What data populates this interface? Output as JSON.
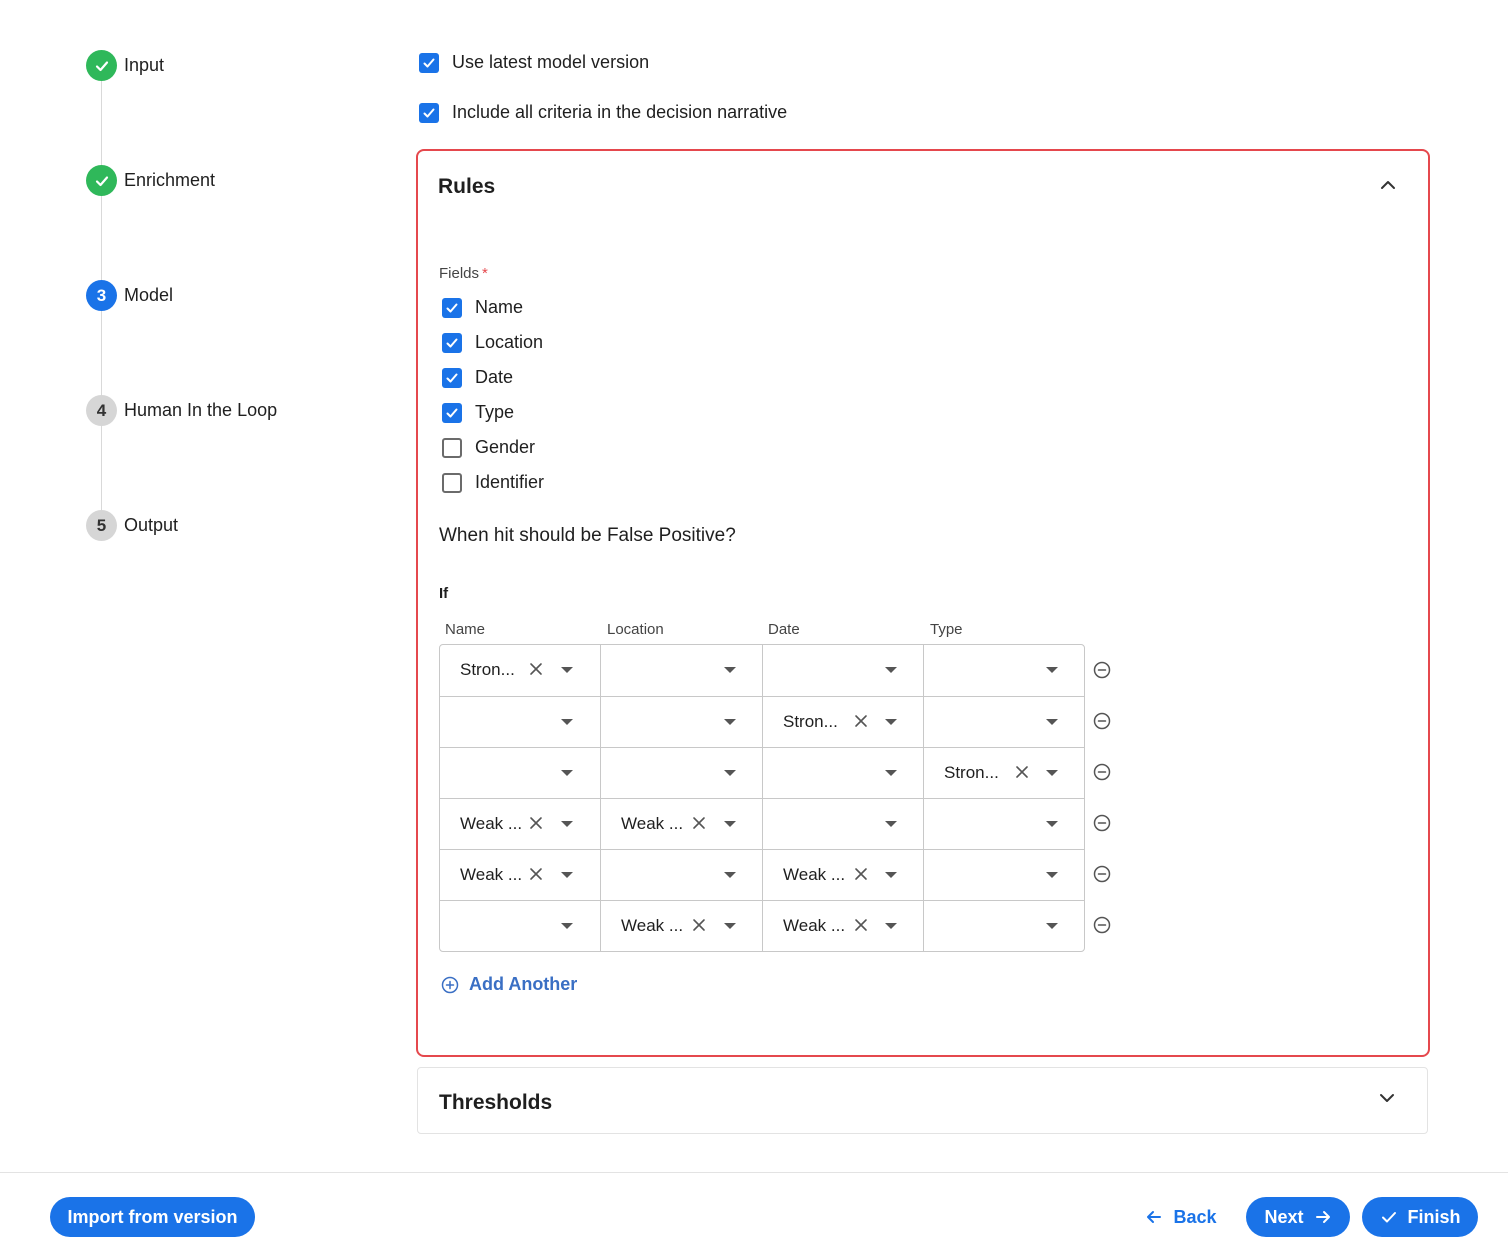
{
  "stepper": {
    "steps": [
      {
        "label": "Input",
        "marker": "",
        "state": "done"
      },
      {
        "label": "Enrichment",
        "marker": "",
        "state": "done"
      },
      {
        "label": "Model",
        "marker": "3",
        "state": "active"
      },
      {
        "label": "Human In the Loop",
        "marker": "4",
        "state": "pending"
      },
      {
        "label": "Output",
        "marker": "5",
        "state": "pending"
      }
    ]
  },
  "options": {
    "use_latest": {
      "label": "Use latest model version",
      "checked": true
    },
    "include_all": {
      "label": "Include all criteria in the decision narrative",
      "checked": true
    }
  },
  "rules": {
    "title": "Rules",
    "fields_label": "Fields",
    "required_mark": "*",
    "fields": [
      {
        "label": "Name",
        "checked": true
      },
      {
        "label": "Location",
        "checked": true
      },
      {
        "label": "Date",
        "checked": true
      },
      {
        "label": "Type",
        "checked": true
      },
      {
        "label": "Gender",
        "checked": false
      },
      {
        "label": "Identifier",
        "checked": false
      }
    ],
    "question": "When hit should be False Positive?",
    "if_label": "If",
    "columns": [
      "Name",
      "Location",
      "Date",
      "Type"
    ],
    "rows": [
      [
        "Stron...",
        "",
        "",
        ""
      ],
      [
        "",
        "",
        "Stron...",
        ""
      ],
      [
        "",
        "",
        "",
        "Stron..."
      ],
      [
        "Weak ...",
        "Weak ...",
        "",
        ""
      ],
      [
        "Weak ...",
        "",
        "Weak ...",
        ""
      ],
      [
        "",
        "Weak ...",
        "Weak ...",
        ""
      ]
    ],
    "add_another": "Add Another"
  },
  "thresholds": {
    "title": "Thresholds"
  },
  "footer": {
    "import_label": "Import from version",
    "back_label": "Back",
    "next_label": "Next",
    "finish_label": "Finish"
  },
  "colors": {
    "primary": "#1a73e8",
    "done": "#2fb85a",
    "highlight_border": "#e5484d",
    "link": "#3a6fc4"
  }
}
